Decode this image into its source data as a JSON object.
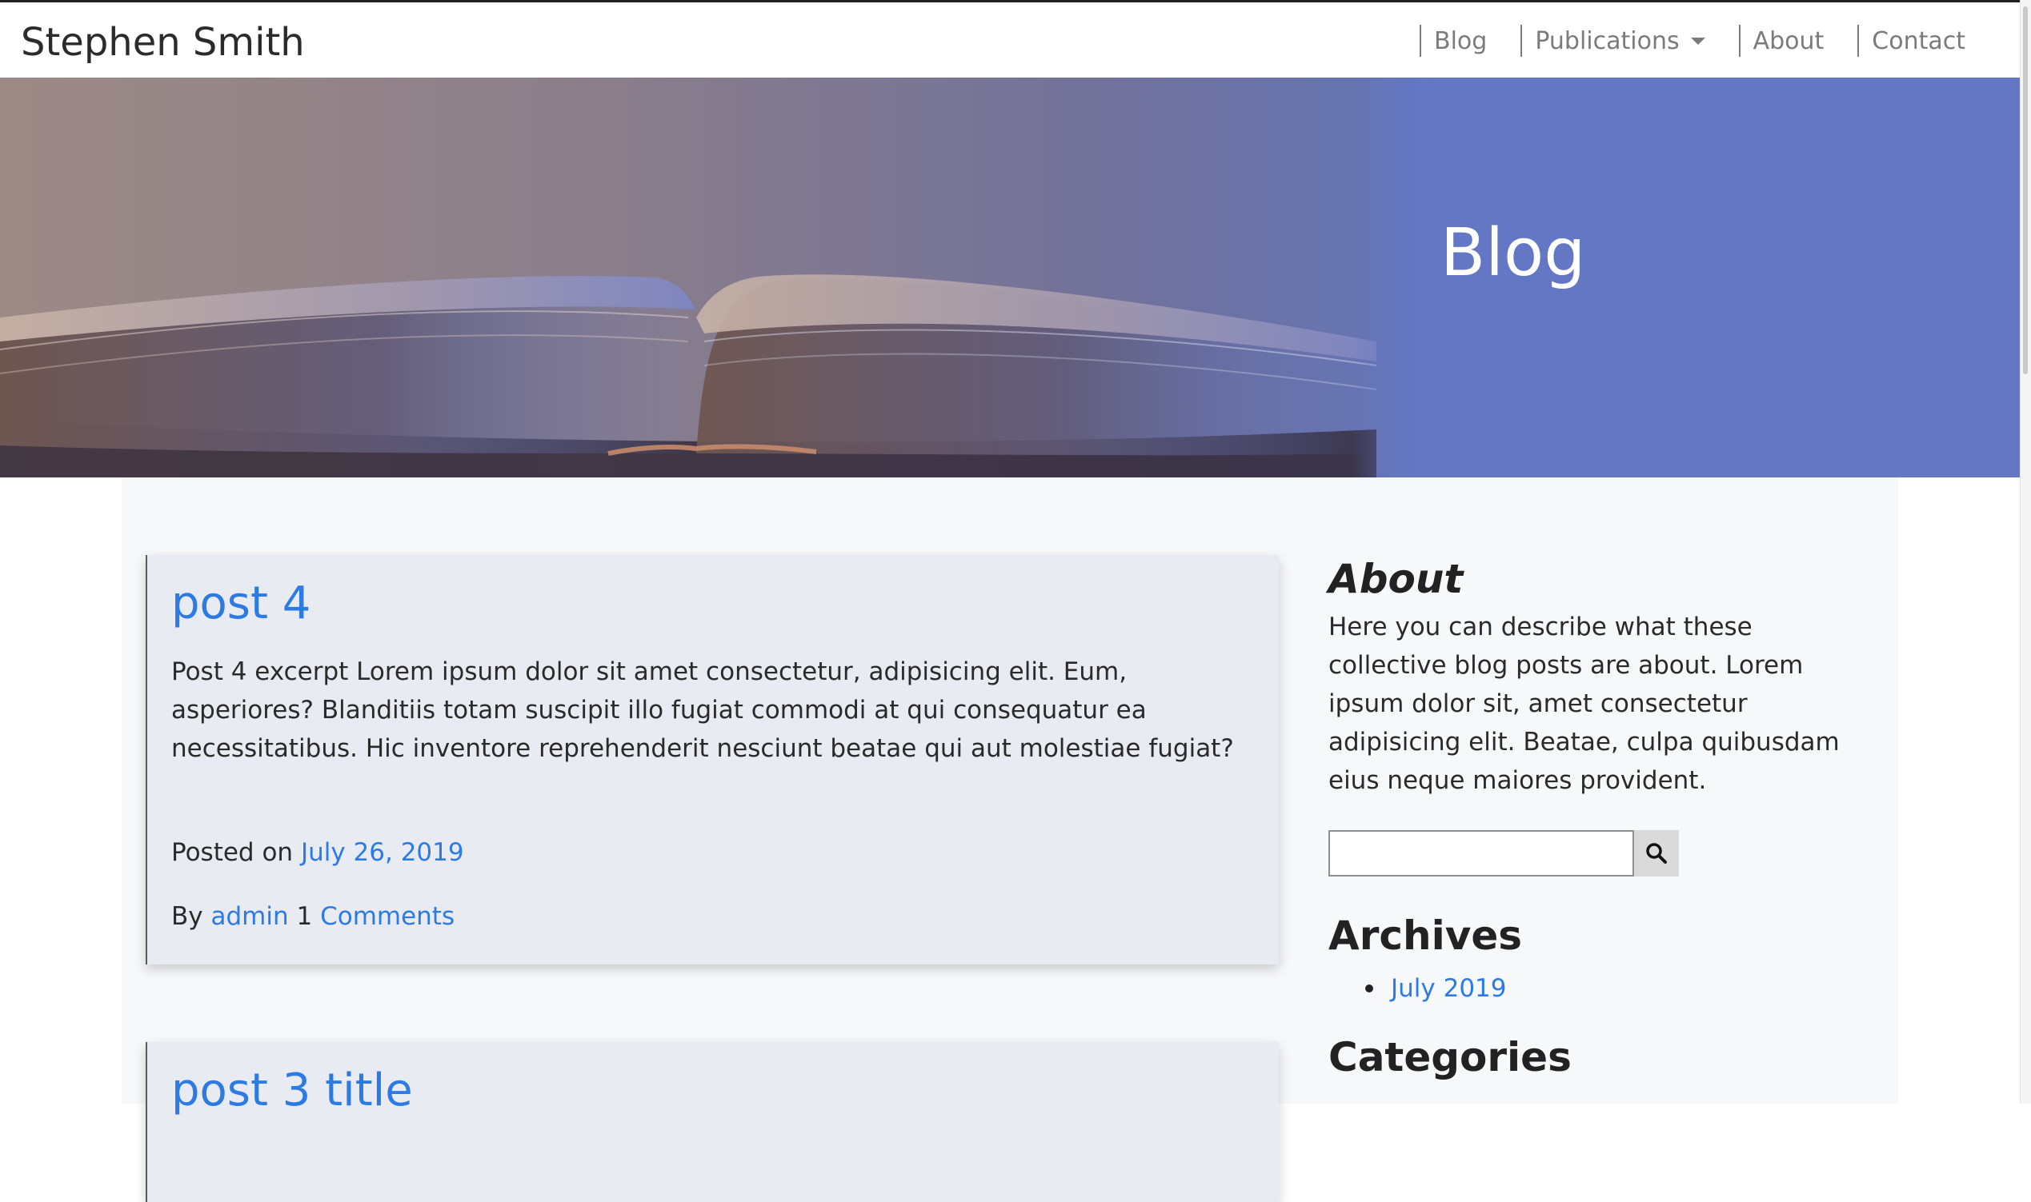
{
  "site": {
    "brand": "Stephen Smith"
  },
  "nav": {
    "items": [
      {
        "label": "Blog"
      },
      {
        "label": "Publications",
        "dropdown": true
      },
      {
        "label": "About"
      },
      {
        "label": "Contact"
      }
    ]
  },
  "hero": {
    "title": "Blog",
    "accent_color": "#6377c5"
  },
  "posts": [
    {
      "title": "post 4",
      "excerpt": "Post 4 excerpt Lorem ipsum dolor sit amet consectetur, adipisicing elit. Eum, asperiores? Blanditiis totam suscipit illo fugiat commodi at qui consequatur ea necessitatibus. Hic inventore reprehenderit nesciunt beatae qui aut molestiae fugiat?",
      "posted_on_label": "Posted on",
      "date": "July 26, 2019",
      "by_label": "By",
      "author": "admin",
      "comment_count": "1",
      "comments_label": "Comments"
    },
    {
      "title": "post 3 title"
    }
  ],
  "sidebar": {
    "about_heading": "About",
    "about_text": "Here you can describe what these collective blog posts are about. Lorem ipsum dolor sit, amet consectetur adipisicing elit. Beatae, culpa quibusdam eius neque maiores provident.",
    "search": {
      "value": "",
      "button_icon": "search-icon"
    },
    "archives_heading": "Archives",
    "archives": [
      {
        "label": "July 2019"
      }
    ],
    "categories_heading": "Categories"
  },
  "colors": {
    "link": "#2c7be5",
    "card_bg": "#e9ebf3",
    "content_bg": "#f7f8fa"
  }
}
